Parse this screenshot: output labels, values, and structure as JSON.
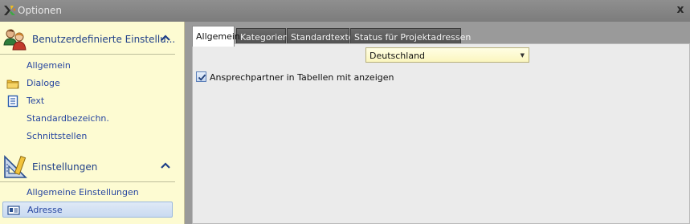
{
  "window": {
    "title": "Optionen",
    "close_glyph": "x"
  },
  "sidebar": {
    "groups": [
      {
        "label": "Benutzerdefinierte Einstellu...",
        "icon": "users-icon",
        "expanded": true,
        "items": [
          {
            "label": "Allgemein",
            "icon": ""
          },
          {
            "label": "Dialoge",
            "icon": "folder-icon"
          },
          {
            "label": "Text",
            "icon": "document-icon"
          },
          {
            "label": "Standardbezeichn.",
            "icon": ""
          },
          {
            "label": "Schnittstellen",
            "icon": ""
          }
        ]
      },
      {
        "label": "Einstellungen",
        "icon": "ruler-triangle-icon",
        "expanded": true,
        "items": [
          {
            "label": "Allgemeine Einstellungen",
            "icon": ""
          },
          {
            "label": "Adresse",
            "icon": "address-card-icon",
            "selected": true
          }
        ]
      }
    ]
  },
  "tabs": [
    {
      "label": "Allgemein",
      "active": true
    },
    {
      "label": "Kategorien",
      "active": false
    },
    {
      "label": "Standardtexte",
      "active": false
    },
    {
      "label": "Status für Projektadressen",
      "active": false
    }
  ],
  "panel": {
    "country_select": {
      "value": "Deutschland"
    },
    "show_contacts_checkbox": {
      "label": "Ansprechpartner in Tabellen mit anzeigen",
      "checked": true
    }
  },
  "colors": {
    "nav_background": "#fdfbd2",
    "nav_link": "#2746a0",
    "tab_inactive": "#5a5a5a",
    "panel_background": "#ebebeb",
    "combo_background": "#fffee4"
  }
}
